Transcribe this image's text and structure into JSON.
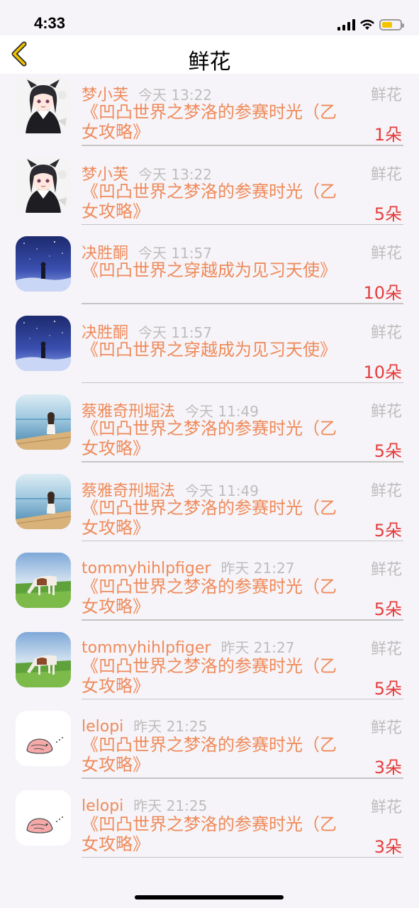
{
  "status_bar": {
    "time": "4:33"
  },
  "nav": {
    "title": "鲜花"
  },
  "items": [
    {
      "name": "梦小芙",
      "time": "今天 13:22",
      "category": "鲜花",
      "message": "《凹凸世界之梦洛的参赛时光（乙女攻略》",
      "count": "1朵",
      "avatar": "anime-girl"
    },
    {
      "name": "梦小芙",
      "time": "今天 13:22",
      "category": "鲜花",
      "message": "《凹凸世界之梦洛的参赛时光（乙女攻略》",
      "count": "5朵",
      "avatar": "anime-girl"
    },
    {
      "name": "决胜酮",
      "time": "今天 11:57",
      "category": "鲜花",
      "message": "《凹凸世界之穿越成为见习天使》",
      "count": "10朵",
      "avatar": "night-sky"
    },
    {
      "name": "决胜酮",
      "time": "今天 11:57",
      "category": "鲜花",
      "message": "《凹凸世界之穿越成为见习天使》",
      "count": "10朵",
      "avatar": "night-sky"
    },
    {
      "name": "蔡雅奇刑堀法",
      "time": "今天 11:49",
      "category": "鲜花",
      "message": "《凹凸世界之梦洛的参赛时光（乙女攻略》",
      "count": "5朵",
      "avatar": "sea-girl"
    },
    {
      "name": "蔡雅奇刑堀法",
      "time": "今天 11:49",
      "category": "鲜花",
      "message": "《凹凸世界之梦洛的参赛时光（乙女攻略》",
      "count": "5朵",
      "avatar": "sea-girl"
    },
    {
      "name": "tommyhihlpfiger",
      "time": "昨天 21:27",
      "category": "鲜花",
      "message": "《凹凸世界之梦洛的参赛时光（乙女攻略》",
      "count": "5朵",
      "avatar": "horse"
    },
    {
      "name": "tommyhihlpfiger",
      "time": "昨天 21:27",
      "category": "鲜花",
      "message": "《凹凸世界之梦洛的参赛时光（乙女攻略》",
      "count": "5朵",
      "avatar": "horse"
    },
    {
      "name": "lelopi",
      "time": "昨天 21:25",
      "category": "鲜花",
      "message": "《凹凸世界之梦洛的参赛时光（乙女攻略》",
      "count": "3朵",
      "avatar": "cartoon-blob"
    },
    {
      "name": "lelopi",
      "time": "昨天 21:25",
      "category": "鲜花",
      "message": "《凹凸世界之梦洛的参赛时光（乙女攻略》",
      "count": "3朵",
      "avatar": "cartoon-blob"
    }
  ]
}
